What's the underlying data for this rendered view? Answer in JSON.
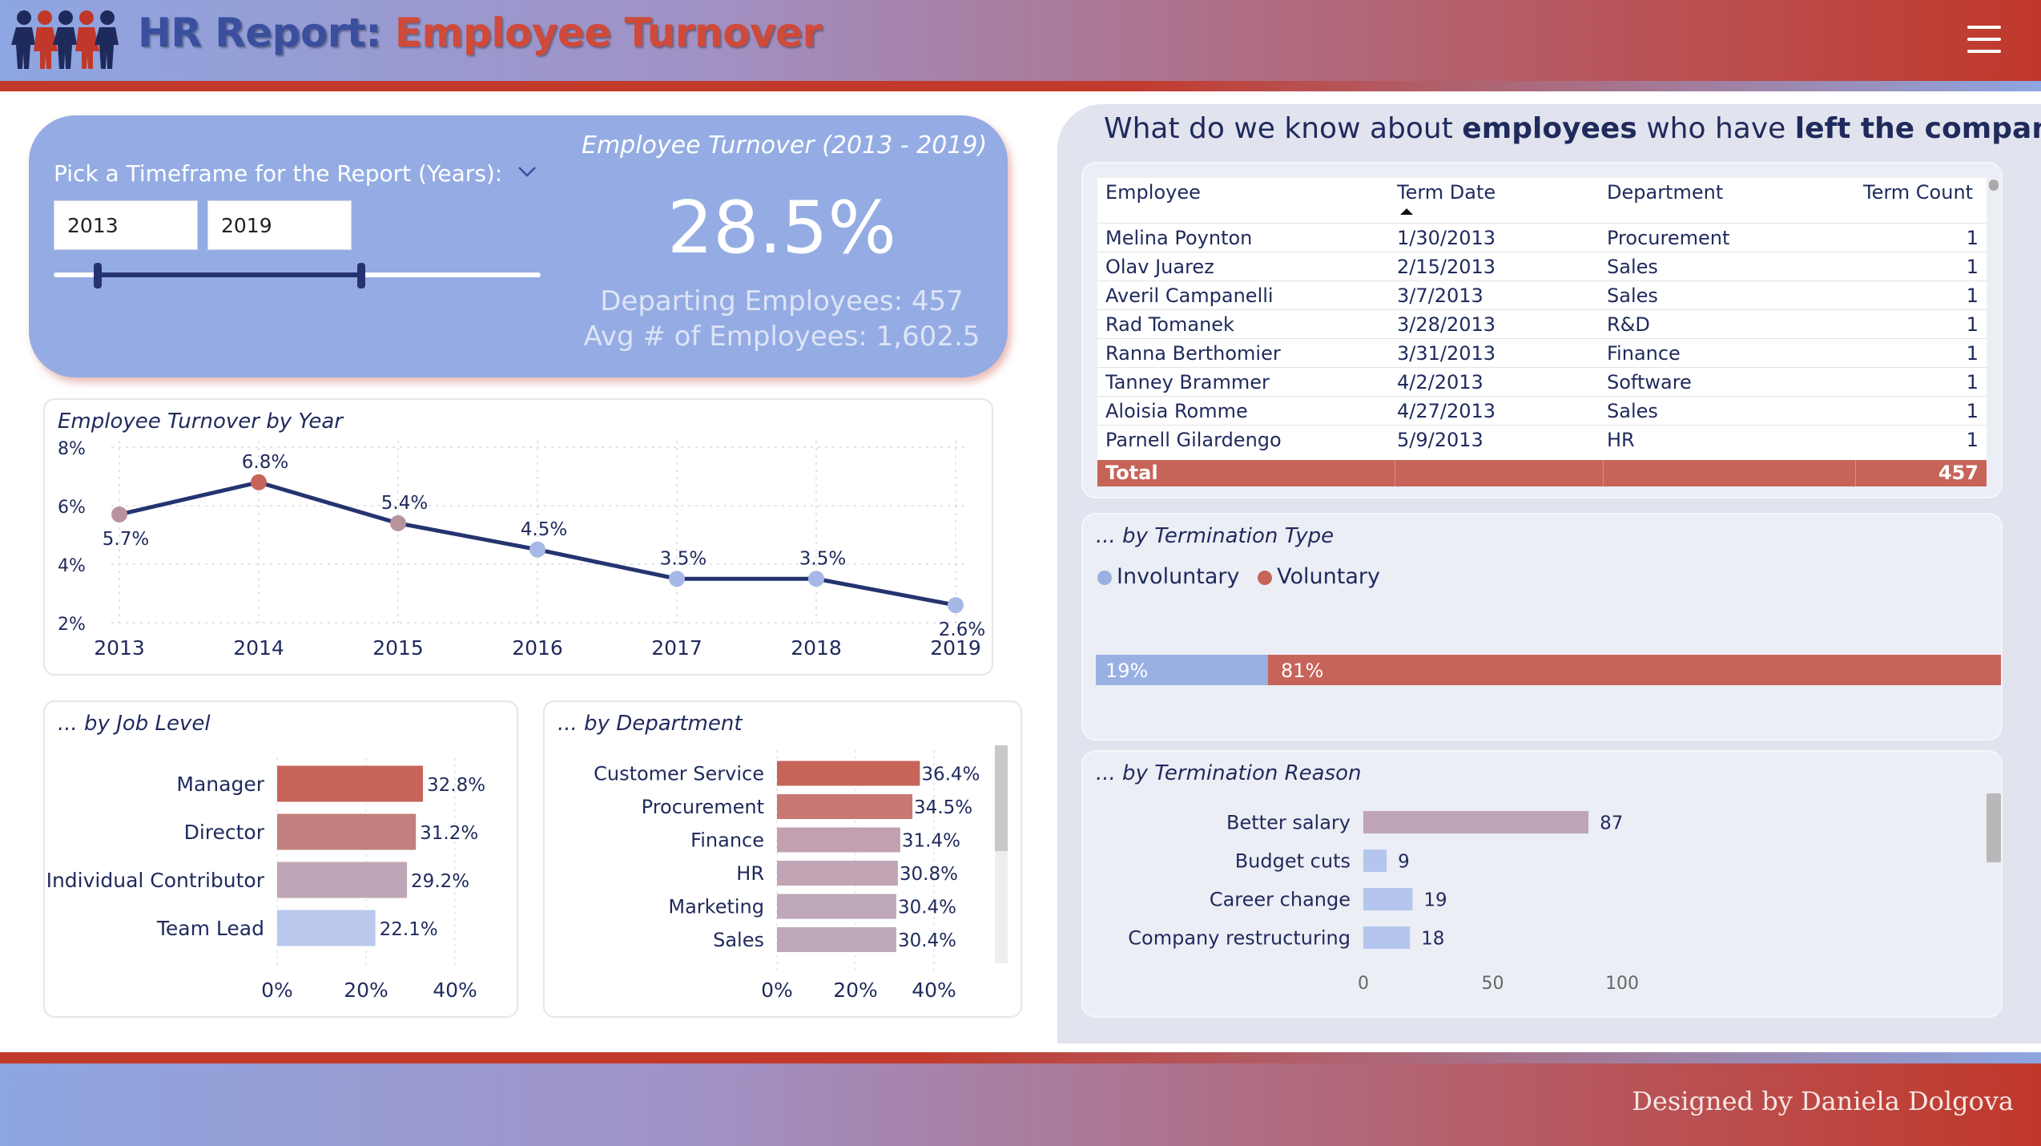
{
  "header": {
    "title_part1": "HR Report:",
    "title_part2": "Employee Turnover",
    "menu_icon": "hamburger-menu-icon",
    "logo_icon": "people-group-icon"
  },
  "footer": {
    "credit": "Designed by Daniela Dolgova"
  },
  "filter": {
    "label": "Pick a Timeframe for the Report (Years):",
    "from_year": "2013",
    "to_year": "2019",
    "slider_range": [
      "2013",
      "2019"
    ]
  },
  "kpi": {
    "title": "Employee Turnover (2013 - 2019)",
    "value": "28.5%",
    "departing": "Departing Employees: 457",
    "avg_employees": "Avg # of Employees: 1,602.5"
  },
  "colors": {
    "navy": "#1f2a5c",
    "line": "#253370",
    "red": "#c7645a",
    "blue_light": "#9ab0e2",
    "mauve": "#bfa6b6",
    "card_blue": "#94ace3"
  },
  "right": {
    "question_pre": "What do we know about ",
    "question_b1": "employees",
    "question_mid": " who have ",
    "question_b2": "left the company",
    "question_post": "?"
  },
  "table": {
    "headers": [
      "Employee",
      "Term Date",
      "Department",
      "Term Count"
    ],
    "sort_column": "Term Date",
    "rows": [
      [
        "Melina Poynton",
        "1/30/2013",
        "Procurement",
        "1"
      ],
      [
        "Olav Juarez",
        "2/15/2013",
        "Sales",
        "1"
      ],
      [
        "Averil Campanelli",
        "3/7/2013",
        "Sales",
        "1"
      ],
      [
        "Rad Tomanek",
        "3/28/2013",
        "R&D",
        "1"
      ],
      [
        "Ranna Berthomier",
        "3/31/2013",
        "Finance",
        "1"
      ],
      [
        "Tanney Brammer",
        "4/2/2013",
        "Software",
        "1"
      ],
      [
        "Aloisia Romme",
        "4/27/2013",
        "Sales",
        "1"
      ],
      [
        "Parnell Gilardengo",
        "5/9/2013",
        "HR",
        "1"
      ]
    ],
    "total_label": "Total",
    "total_value": "457"
  },
  "chart_data": [
    {
      "id": "turnover_by_year",
      "type": "line",
      "title": "Employee Turnover by Year",
      "x": [
        "2013",
        "2014",
        "2015",
        "2016",
        "2017",
        "2018",
        "2019"
      ],
      "values": [
        5.7,
        6.8,
        5.4,
        4.5,
        3.5,
        3.5,
        2.6
      ],
      "labels": [
        "5.7%",
        "6.8%",
        "5.4%",
        "4.5%",
        "3.5%",
        "3.5%",
        "2.6%"
      ],
      "yticks": [
        "8%",
        "6%",
        "4%",
        "2%"
      ],
      "ylim": [
        2,
        8
      ],
      "grid": true
    },
    {
      "id": "by_job_level",
      "type": "bar",
      "orientation": "horizontal",
      "title": "... by Job Level",
      "categories": [
        "Manager",
        "Director",
        "Individual Contributor",
        "Team Lead"
      ],
      "values": [
        32.8,
        31.2,
        29.2,
        22.1
      ],
      "labels": [
        "32.8%",
        "31.2%",
        "29.2%",
        "22.1%"
      ],
      "xticks": [
        "0%",
        "20%",
        "40%"
      ],
      "xlim": [
        0,
        40
      ],
      "colors": [
        "#c7645a",
        "#c2817e",
        "#bfa6b6",
        "#b9c8ec"
      ]
    },
    {
      "id": "by_department",
      "type": "bar",
      "orientation": "horizontal",
      "title": "... by Department",
      "categories": [
        "Customer Service",
        "Procurement",
        "Finance",
        "HR",
        "Marketing",
        "Sales"
      ],
      "values": [
        36.4,
        34.5,
        31.4,
        30.8,
        30.4,
        30.4
      ],
      "labels": [
        "36.4%",
        "34.5%",
        "31.4%",
        "30.8%",
        "30.4%",
        "30.4%"
      ],
      "xticks": [
        "0%",
        "20%",
        "40%"
      ],
      "xlim": [
        0,
        40
      ],
      "colors": [
        "#c7645a",
        "#c77872",
        "#c2a0b0",
        "#c1a5b5",
        "#bfa8b8",
        "#bfa8b8"
      ]
    },
    {
      "id": "by_termination_type",
      "type": "bar",
      "stacked": true,
      "title": "... by Termination Type",
      "series": [
        {
          "name": "Involuntary",
          "values": [
            19
          ]
        },
        {
          "name": "Voluntary",
          "values": [
            81
          ]
        }
      ],
      "labels": [
        "19%",
        "81%"
      ]
    },
    {
      "id": "by_termination_reason",
      "type": "bar",
      "orientation": "horizontal",
      "title": "... by Termination Reason",
      "categories": [
        "Better salary",
        "Budget cuts",
        "Career change",
        "Company restructuring"
      ],
      "values": [
        87,
        9,
        19,
        18
      ],
      "labels": [
        "87",
        "9",
        "19",
        "18"
      ],
      "xticks": [
        "0",
        "50",
        "100"
      ],
      "xlim": [
        0,
        130
      ],
      "colors": [
        "#bfa6b6",
        "#b4c6ee",
        "#b4c6ee",
        "#b4c6ee"
      ]
    }
  ]
}
